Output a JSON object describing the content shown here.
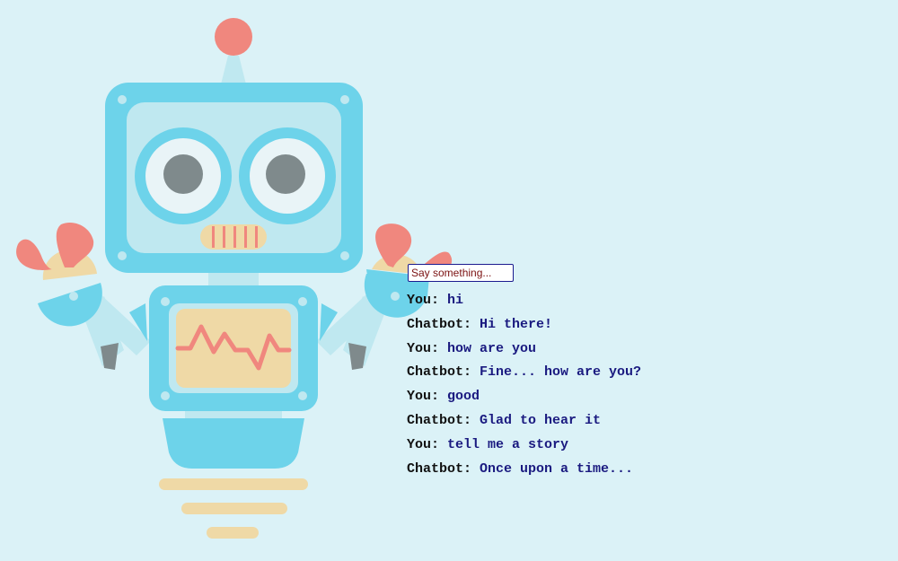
{
  "chat": {
    "input_placeholder": "Say something...",
    "messages": [
      {
        "speaker": "You:",
        "text": "hi"
      },
      {
        "speaker": "Chatbot:",
        "text": "Hi there!"
      },
      {
        "speaker": "You:",
        "text": "how are you"
      },
      {
        "speaker": "Chatbot:",
        "text": "Fine... how are you?"
      },
      {
        "speaker": "You:",
        "text": "good"
      },
      {
        "speaker": "Chatbot:",
        "text": "Glad to hear it"
      },
      {
        "speaker": "You:",
        "text": "tell me a story"
      },
      {
        "speaker": "Chatbot:",
        "text": "Once upon a time..."
      }
    ]
  },
  "colors": {
    "background": "#dbf2f7",
    "robot_blue": "#6dd3ea",
    "robot_light": "#bfe8f0",
    "accent_red": "#f0877e",
    "accent_sand": "#efd9a6",
    "eye_pupil": "#7f8a8c",
    "text_speaker": "#111111",
    "text_message": "#1a1a80"
  }
}
